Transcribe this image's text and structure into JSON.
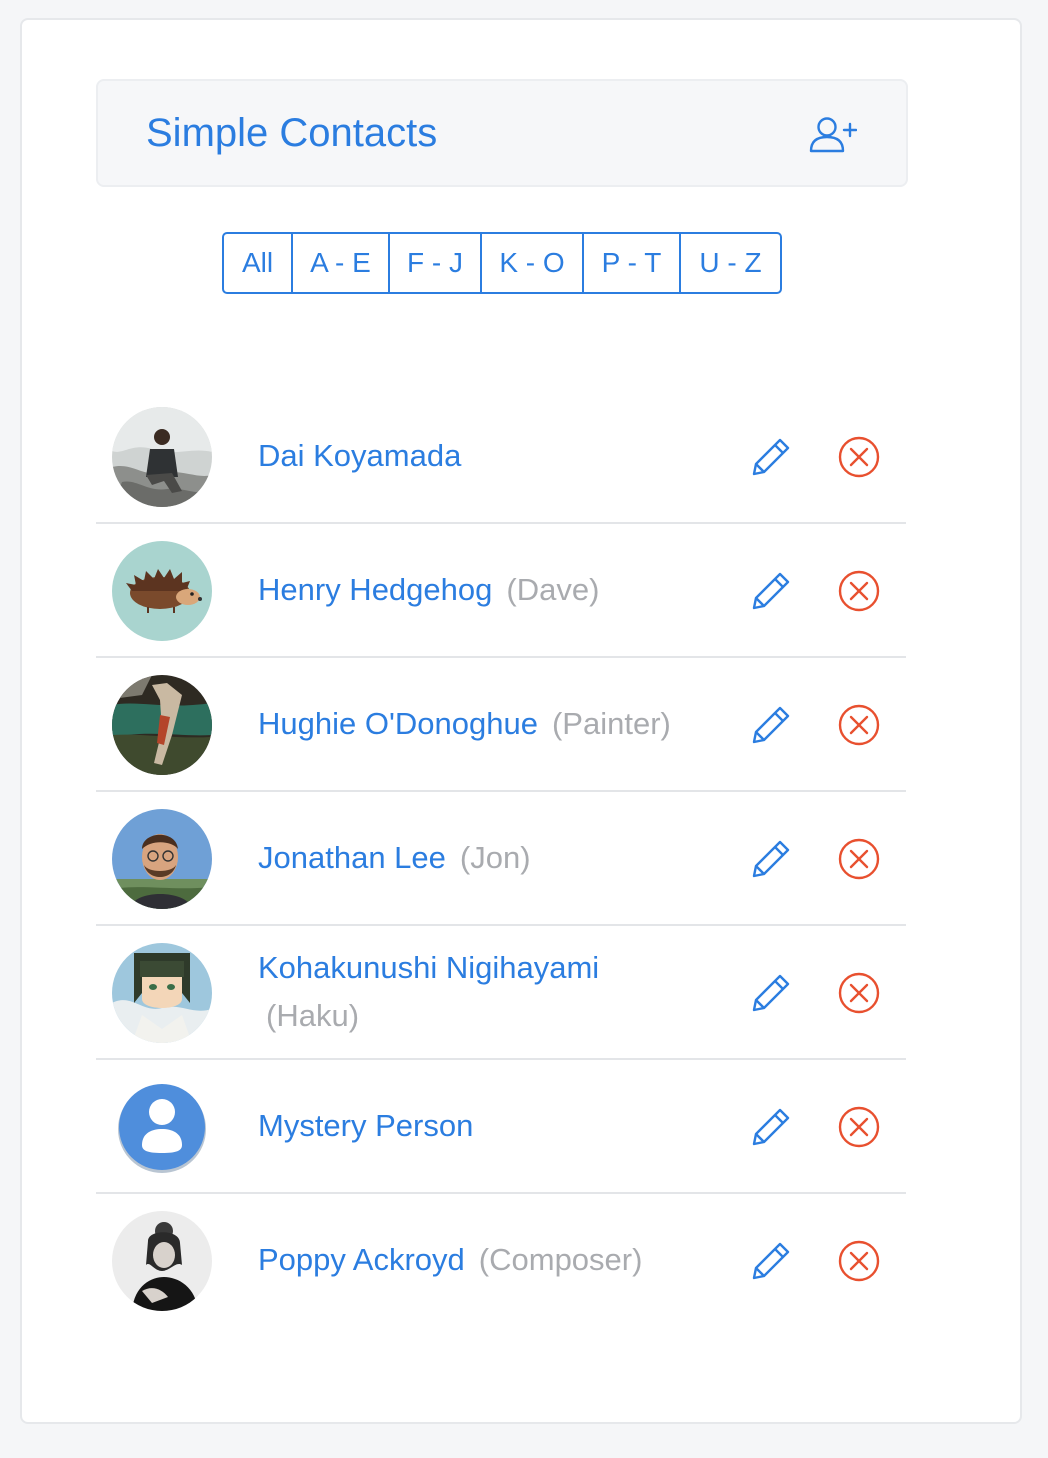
{
  "app": {
    "title": "Simple Contacts",
    "add_icon": "add-user-icon"
  },
  "filters": [
    "All",
    "A - E",
    "F - J",
    "K - O",
    "P - T",
    "U - Z"
  ],
  "contacts": [
    {
      "name": "Dai Koyamada",
      "nickname": "",
      "avatar": "photo-man-on-rocks"
    },
    {
      "name": "Henry Hedgehog",
      "nickname": "(Dave)",
      "avatar": "hedgehog-drawing"
    },
    {
      "name": "Hughie O'Donoghue",
      "nickname": "(Painter)",
      "avatar": "abstract-painting"
    },
    {
      "name": "Jonathan Lee",
      "nickname": "(Jon)",
      "avatar": "photo-bearded-man"
    },
    {
      "name": "Kohakunushi Nigihayami",
      "nickname": "(Haku)",
      "avatar": "anime-character"
    },
    {
      "name": "Mystery Person",
      "nickname": "",
      "avatar": "default-person-icon"
    },
    {
      "name": "Poppy Ackroyd",
      "nickname": "(Composer)",
      "avatar": "photo-woman-bw"
    }
  ],
  "colors": {
    "accent": "#2b7de0",
    "danger": "#e8502f",
    "muted": "#a9abaf",
    "header_bg": "#f6f7f9"
  }
}
